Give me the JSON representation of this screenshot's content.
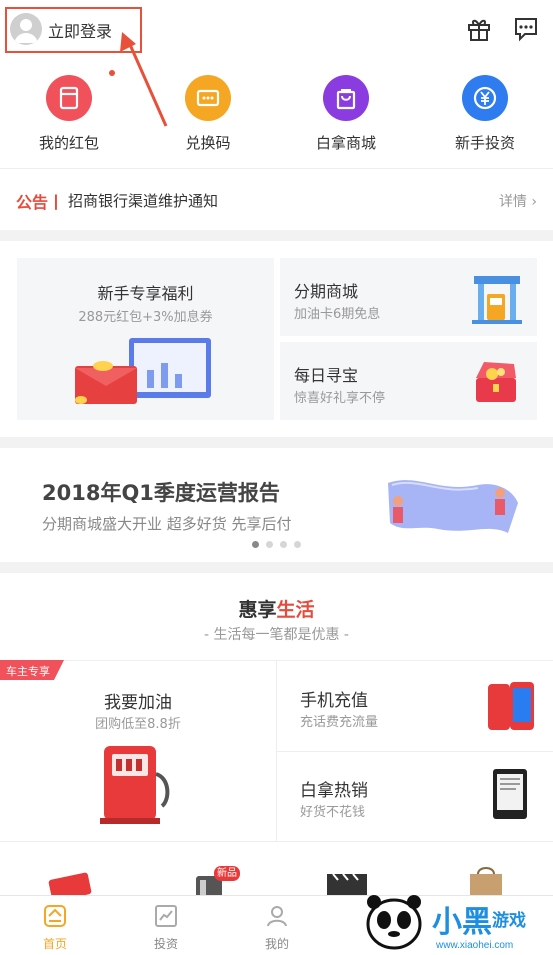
{
  "header": {
    "login_text": "立即登录",
    "accent_color": "#e8503a"
  },
  "quick_entries": [
    {
      "label": "我的红包",
      "icon": "red-envelope-icon",
      "color": "#f0515b"
    },
    {
      "label": "兑换码",
      "icon": "redeem-code-icon",
      "color": "#f5a623"
    },
    {
      "label": "白拿商城",
      "icon": "shopping-bag-icon",
      "color": "#8a3ce0"
    },
    {
      "label": "新手投资",
      "icon": "yuan-coin-icon",
      "color": "#2f7cf0"
    }
  ],
  "notice": {
    "tag": "公告丨",
    "text": "招商银行渠道维护通知",
    "more": "详情 ›"
  },
  "cards": {
    "newbie": {
      "title": "新手专享福利",
      "subtitle": "288元红包+3%加息券"
    },
    "installment": {
      "title": "分期商城",
      "subtitle": "加油卡6期免息"
    },
    "treasure": {
      "title": "每日寻宝",
      "subtitle": "惊喜好礼享不停"
    }
  },
  "banner": {
    "title": "2018年Q1季度运营报告",
    "subtitle": "分期商城盛大开业 超多好货 先享后付",
    "active_dot": 0
  },
  "life": {
    "title_a": "惠享",
    "title_b": "生活",
    "subtitle": "- 生活每一笔都是优惠 -",
    "tag": "车主专享",
    "fuel": {
      "title": "我要加油",
      "subtitle": "团购低至8.8折"
    },
    "recharge": {
      "title": "手机充值",
      "subtitle": "充话费充流量"
    },
    "hot": {
      "title": "白拿热销",
      "subtitle": "好货不花钱"
    },
    "new_badge": "新品"
  },
  "tabbar": [
    {
      "label": "首页",
      "icon": "home-icon",
      "active": true
    },
    {
      "label": "投资",
      "icon": "chart-icon",
      "active": false
    },
    {
      "label": "我的",
      "icon": "user-icon",
      "active": false
    }
  ],
  "watermark": {
    "text": "小黑游戏",
    "url": "www.xiaohei.com"
  }
}
